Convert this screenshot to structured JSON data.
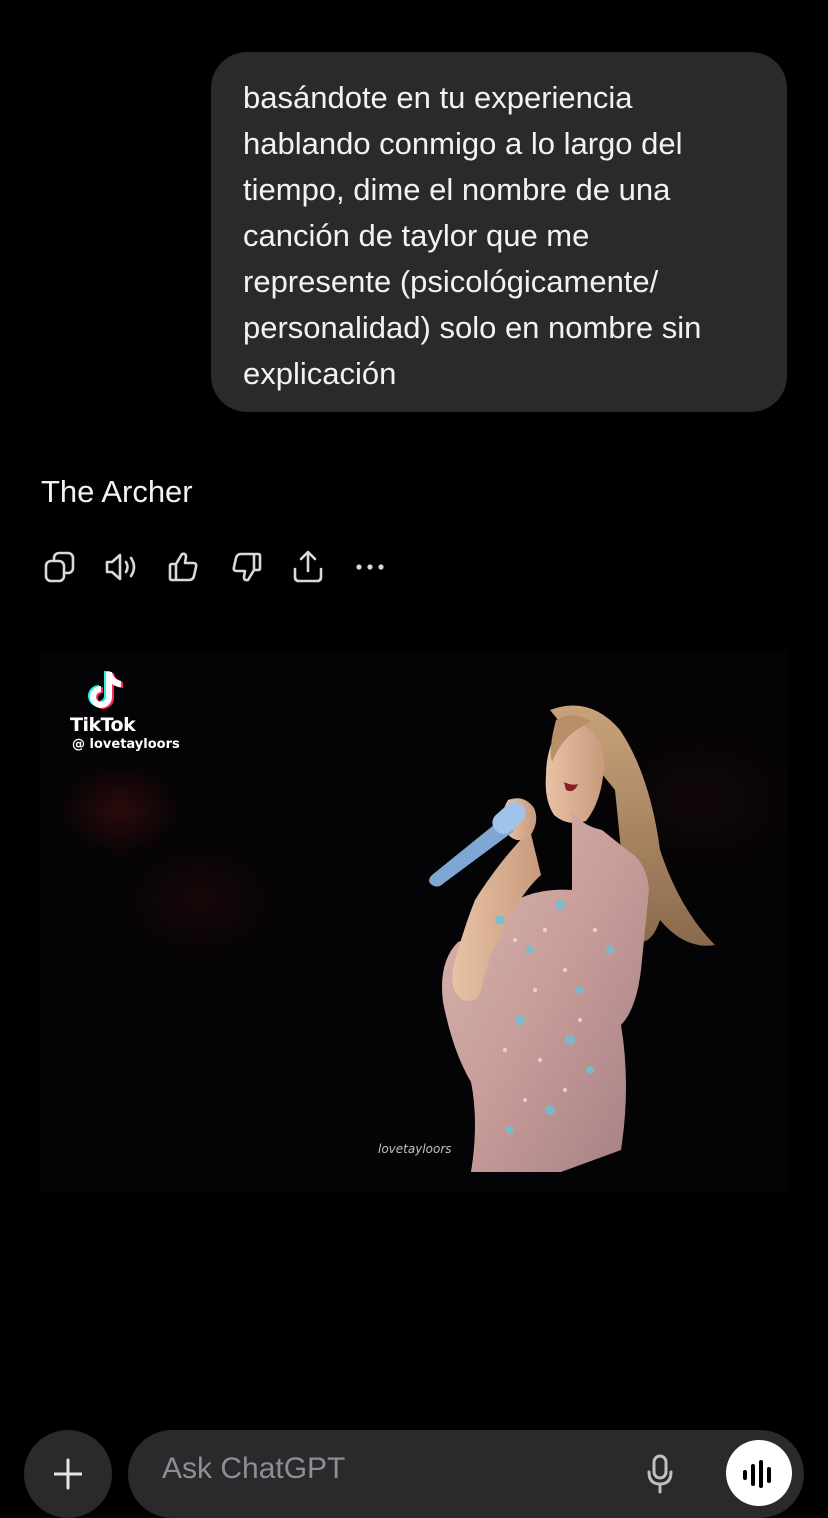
{
  "conversation": {
    "user_message": "basándote en tu experiencia\nhablando conmigo a lo largo del\ntiempo, dime el nombre de una\ncanción de taylor que me\nrepresente (psicológicamente/\npersonalidad) solo en nombre sin\nexplicación",
    "assistant_message": "The Archer"
  },
  "message_actions": [
    {
      "icon": "copy-icon"
    },
    {
      "icon": "speaker-icon"
    },
    {
      "icon": "thumbs-up-icon"
    },
    {
      "icon": "thumbs-down-icon"
    },
    {
      "icon": "share-icon"
    },
    {
      "icon": "more-icon"
    }
  ],
  "media": {
    "brand": "TikTok",
    "handle": "@ lovetayloors",
    "watermark": "lovetayloors"
  },
  "composer": {
    "placeholder": "Ask ChatGPT"
  },
  "colors": {
    "background": "#000000",
    "bubble": "#2a2a2c",
    "text": "#f2f2f2",
    "icon": "#d9d9d9",
    "placeholder": "#8e8e93"
  }
}
